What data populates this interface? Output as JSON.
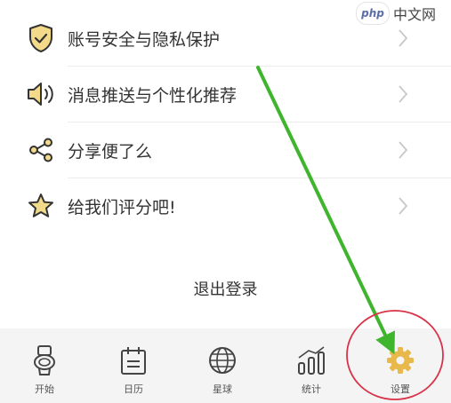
{
  "watermark": {
    "logo_text": "php",
    "site_text": "中文网"
  },
  "menu": {
    "items": [
      {
        "label": "账号安全与隐私保护",
        "icon": "shield-check-icon"
      },
      {
        "label": "消息推送与个性化推荐",
        "icon": "speaker-icon"
      },
      {
        "label": "分享便了么",
        "icon": "share-icon"
      },
      {
        "label": "给我们评分吧!",
        "icon": "star-icon"
      }
    ]
  },
  "logout": {
    "label": "退出登录"
  },
  "tabbar": {
    "tabs": [
      {
        "label": "开始",
        "icon": "toilet-icon"
      },
      {
        "label": "日历",
        "icon": "calendar-icon"
      },
      {
        "label": "星球",
        "icon": "globe-icon"
      },
      {
        "label": "统计",
        "icon": "chart-icon"
      },
      {
        "label": "设置",
        "icon": "gear-icon",
        "highlighted": true
      }
    ]
  },
  "colors": {
    "icon_fill": "#f3d98a",
    "icon_stroke": "#333333",
    "annotation_arrow": "#3fb52e",
    "annotation_circle": "#d9334a",
    "gear_active": "#e8b94a"
  }
}
